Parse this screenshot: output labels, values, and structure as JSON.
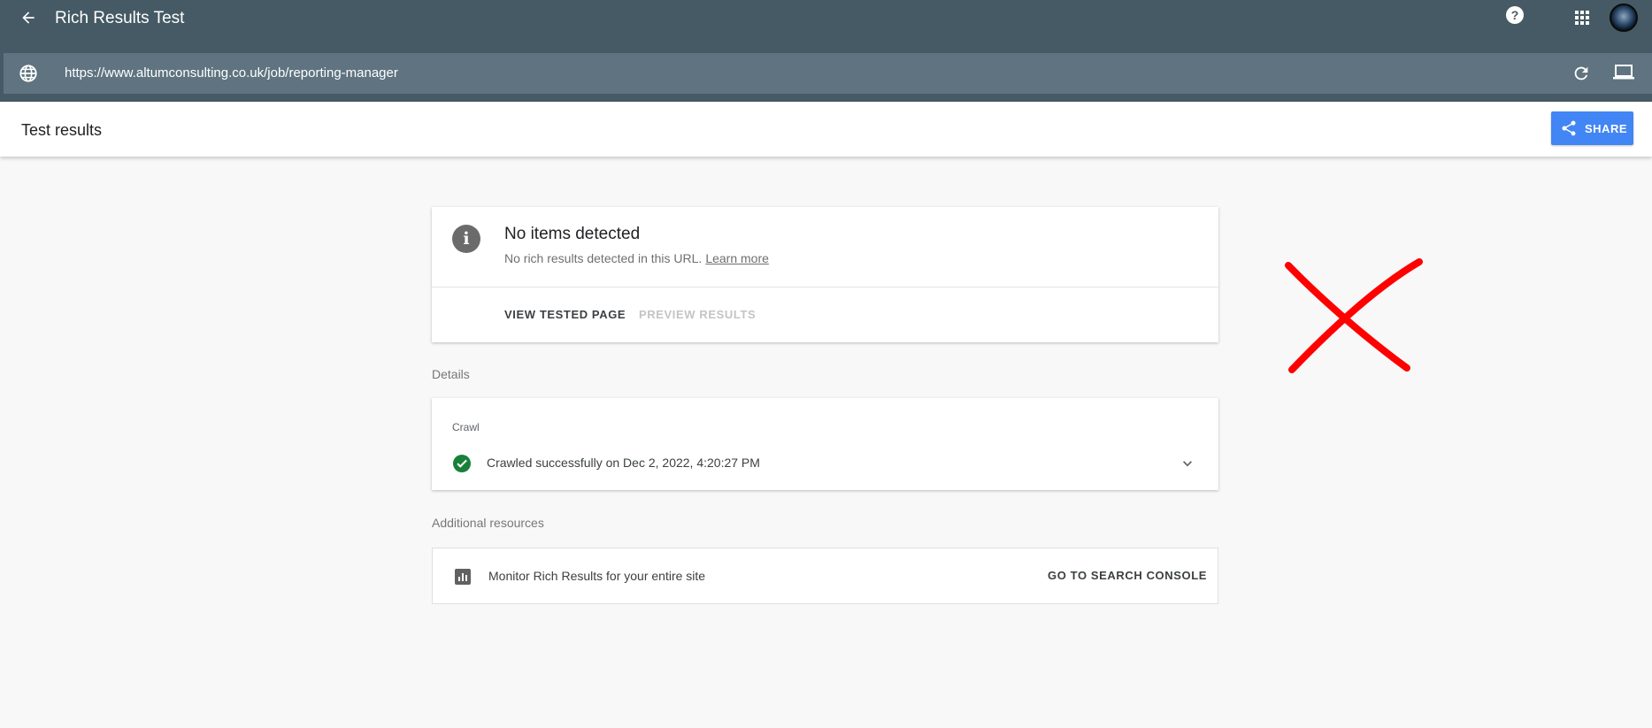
{
  "app": {
    "title": "Rich Results Test"
  },
  "urlbar": {
    "url": "https://www.altumconsulting.co.uk/job/reporting-manager"
  },
  "header": {
    "title": "Test results",
    "share_label": "SHARE"
  },
  "summary": {
    "title": "No items detected",
    "subtitle": "No rich results detected in this URL.",
    "learn_more": "Learn more",
    "view_tested_page": "VIEW TESTED PAGE",
    "preview_results": "PREVIEW RESULTS"
  },
  "details": {
    "label": "Details",
    "crawl_caption": "Crawl",
    "crawl_status": "Crawled successfully on Dec 2, 2022, 4:20:27 PM"
  },
  "resources": {
    "label": "Additional resources",
    "monitor_text": "Monitor Rich Results for your entire site",
    "console_link": "GO TO SEARCH CONSOLE"
  },
  "icons": {
    "back": "arrow-back-icon",
    "help": "help-icon",
    "apps": "apps-grid-icon",
    "globe": "globe-icon",
    "refresh": "refresh-icon",
    "device": "laptop-icon",
    "share": "share-icon",
    "info": "info-icon",
    "check": "check-circle-icon",
    "chevron": "chevron-down-icon",
    "chart": "bar-chart-icon"
  },
  "colors": {
    "appbar": "#455a64",
    "urlbar": "#5f7480",
    "share_button": "#4285f4",
    "success": "#188038",
    "annotation": "#ff0000"
  }
}
